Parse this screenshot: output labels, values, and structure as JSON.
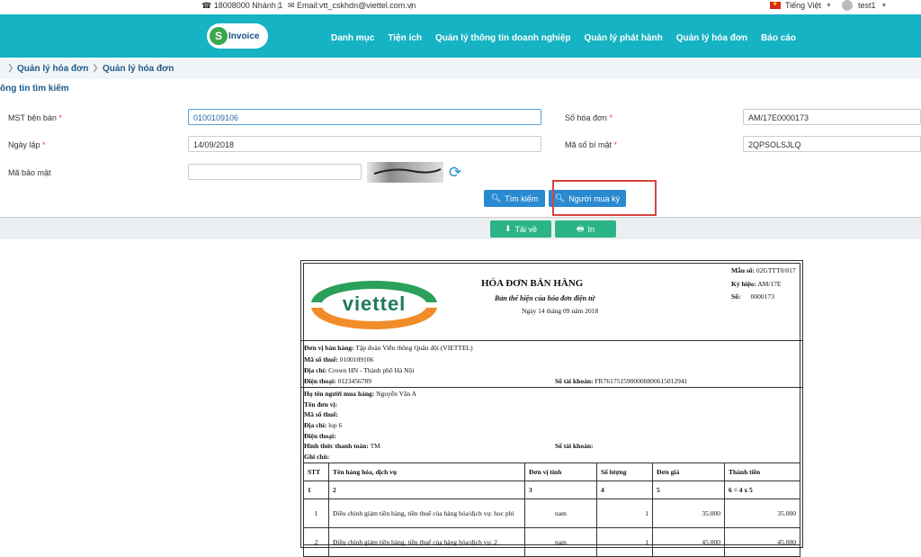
{
  "topbar": {
    "phone": "☎ 18008000 Nhánh 1",
    "email": "✉ Email:vtt_cskhdn@viettel.com.vn",
    "language": "Tiếng Việt",
    "user": "test1"
  },
  "navbar": {
    "logo_text": "Invoice",
    "logo_letter": "S",
    "menu": [
      "Danh mục",
      "Tiện ích",
      "Quản lý thông tin doanh nghiệp",
      "Quản lý phát hành",
      "Quản lý hóa đơn",
      "Báo cáo"
    ]
  },
  "breadcrumb": [
    "Quản lý hóa đơn",
    "Quản lý hóa đơn"
  ],
  "search": {
    "title": "ông tin tìm kiếm",
    "mst_label": "MST bên bán",
    "mst_value": "0100109106",
    "date_label": "Ngày lập",
    "date_value": "14/09/2018",
    "security_label": "Mã bảo mật",
    "security_value": "",
    "invoice_no_label": "Số hóa đơn",
    "invoice_no_value": "AM/17E0000173",
    "secret_label": "Mã số bí mật",
    "secret_value": "2QPSOLSJLQ",
    "required_mark": "*",
    "search_button": "Tìm kiếm",
    "buyer_sign_button": "Người mua ký",
    "download_button": "Tải về",
    "print_button": "In"
  },
  "invoice": {
    "logo_text": "viettel",
    "title": "HÓA ĐƠN BÁN HÀNG",
    "subtitle": "Bản thể hiện của hóa đơn điện tử",
    "date": "Ngày 14 tháng 09 năm 2018",
    "form_label": "Mẫu số:",
    "form_value": "02GTTT0/017",
    "symbol_label": "Ký hiệu:",
    "symbol_value": "AM/17E",
    "number_label": "Số:",
    "number_value": "0000173",
    "seller_label": "Đơn vị bán hàng:",
    "seller_value": "Tập đoàn Viễn thông Quân đội (VIETTEL)",
    "seller_tax_label": "Mã số thuế:",
    "seller_tax_value": "0100109106",
    "seller_addr_label": "Địa chỉ:",
    "seller_addr_value": "Crown HN - Thành phố Hà Nội",
    "seller_phone_label": "Điện thoại:",
    "seller_phone_value": "0123456789",
    "seller_account_label": "Số tài khoản:",
    "seller_account_value": "FR7617515900000800615012941",
    "buyer_name_label": "Họ tên người mua hàng:",
    "buyer_name_value": "Nguyễn Văn A",
    "buyer_unit_label": "Tên đơn vị:",
    "buyer_tax_label": "Mã số thuế:",
    "buyer_addr_label": "Địa chỉ:",
    "buyer_addr_value": "lop 6",
    "buyer_phone_label": "Điện thoại:",
    "payment_label": "Hình thức thanh toán:",
    "payment_value": "TM",
    "buyer_account_label": "Số tài khoản:",
    "note_label": "Ghi chú:",
    "columns": [
      "STT",
      "Tên hàng hóa, dịch vụ",
      "Đơn vị tính",
      "Số lượng",
      "Đơn giá",
      "Thành tiền"
    ],
    "column_index": [
      "1",
      "2",
      "3",
      "4",
      "5",
      "6 = 4 x 5"
    ],
    "rows": [
      {
        "stt": "1",
        "name": "Điều chỉnh giảm tiền hàng, tiền thuế của hàng hóa/dịch vụ: hoc phi",
        "unit": "nam",
        "qty": "1",
        "price": "35.000",
        "total": "35.000"
      },
      {
        "stt": "2",
        "name": "Điều chỉnh giảm tiền hàng, tiền thuế của hàng hóa/dịch vụ: 2",
        "unit": "nam",
        "qty": "1",
        "price": "45.000",
        "total": "45.000"
      }
    ]
  }
}
